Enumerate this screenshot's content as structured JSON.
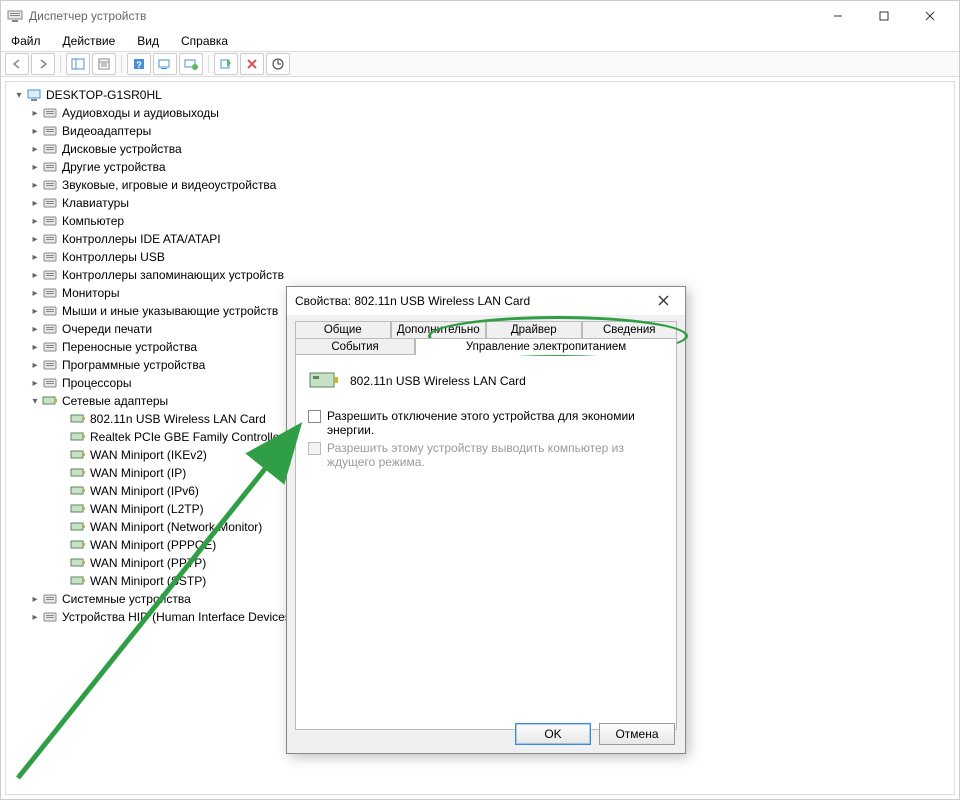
{
  "window": {
    "title": "Диспетчер устройств"
  },
  "menu": {
    "file": "Файл",
    "action": "Действие",
    "view": "Вид",
    "help": "Справка"
  },
  "tree": {
    "root": "DESKTOP-G1SR0HL",
    "categories": [
      "Аудиовходы и аудиовыходы",
      "Видеоадаптеры",
      "Дисковые устройства",
      "Другие устройства",
      "Звуковые, игровые и видеоустройства",
      "Клавиатуры",
      "Компьютер",
      "Контроллеры IDE ATA/ATAPI",
      "Контроллеры USB",
      "Контроллеры запоминающих устройств",
      "Мониторы",
      "Мыши и иные указывающие устройств",
      "Очереди печати",
      "Переносные устройства",
      "Программные устройства",
      "Процессоры"
    ],
    "net_label": "Сетевые адаптеры",
    "net_children": [
      "802.11n USB Wireless LAN Card",
      "Realtek PCIe GBE Family Controller",
      "WAN Miniport (IKEv2)",
      "WAN Miniport (IP)",
      "WAN Miniport (IPv6)",
      "WAN Miniport (L2TP)",
      "WAN Miniport (Network Monitor)",
      "WAN Miniport (PPPOE)",
      "WAN Miniport (PPTP)",
      "WAN Miniport (SSTP)"
    ],
    "tail": [
      "Системные устройства",
      "Устройства HID (Human Interface Devices)"
    ]
  },
  "dialog": {
    "title": "Свойства: 802.11n USB Wireless LAN Card",
    "tabs": {
      "general": "Общие",
      "advanced": "Дополнительно",
      "driver": "Драйвер",
      "details": "Сведения",
      "events": "События",
      "power": "Управление электропитанием"
    },
    "device_name": "802.11n USB Wireless LAN Card",
    "chk_allow_off": "Разрешить отключение этого устройства для экономии энергии.",
    "chk_allow_wake": "Разрешить этому устройству выводить компьютер из ждущего режима.",
    "ok": "OK",
    "cancel": "Отмена"
  }
}
